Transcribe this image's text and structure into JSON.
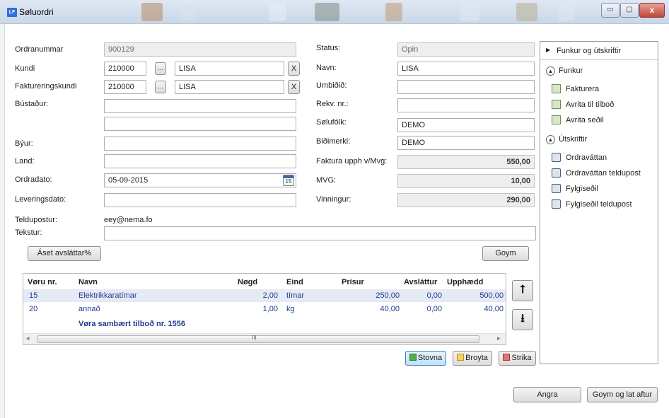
{
  "window": {
    "title": "Søluordri",
    "app_badge": "LF",
    "min": "▭",
    "max": "▢",
    "close": "x"
  },
  "form": {
    "labels": {
      "ordranummar": "Ordranummar",
      "kundi": "Kundi",
      "fakt_kundi": "Faktureringskundi",
      "bustadur": "Bústaður:",
      "byur": "Býur:",
      "land": "Land:",
      "ordradato": "Ordradato:",
      "leveringsdato": "Leveringsdato:",
      "teldupostur": "Teldupostur:",
      "tekstur": "Tekstur:",
      "status": "Status:",
      "navn": "Navn:",
      "umbidid": "Umbiðið:",
      "rekv": "Rekv. nr.:",
      "solufolk": "Sølufólk:",
      "bidimerki": "Biðimerki:",
      "faktura_upph": "Faktura upph v/Mvg:",
      "mvg": "MVG:",
      "vinningur": "Vinningur:"
    },
    "values": {
      "ordranummar": "900129",
      "kundi_nr": "210000",
      "kundi_navn": "LISA",
      "fakt_nr": "210000",
      "fakt_navn": "LISA",
      "bustadur1": "",
      "bustadur2": "",
      "byur": "",
      "land": "",
      "ordradato": "05-09-2015",
      "leveringsdato": "",
      "teldupostur": "eey@nema.fo",
      "tekstur": "",
      "status": "Opin",
      "navn": "LISA",
      "umbidid": "",
      "rekv": "",
      "solufolk": "DEMO",
      "bidimerki": "DEMO",
      "faktura_upph": "550,00",
      "mvg": "10,00",
      "vinningur": "290,00"
    },
    "browse_label": "...",
    "clear_label": "X",
    "calendar_day": "15",
    "aset_button": "Áset avsláttar%",
    "goym_button": "Goym"
  },
  "grid": {
    "headers": [
      "Vøru nr.",
      "Navn",
      "Nøgd",
      "Eind",
      "Prísur",
      "Avsláttur",
      "Upphædd"
    ],
    "rows": [
      {
        "nr": "15",
        "navn": "Elektrikkaratímar",
        "nogd": "2,00",
        "eind": "tímar",
        "prisur": "250,00",
        "avslattur": "0,00",
        "upphaedd": "500,00"
      },
      {
        "nr": "20",
        "navn": "annað",
        "nogd": "1,00",
        "eind": "kg",
        "prisur": "40,00",
        "avslattur": "0,00",
        "upphaedd": "40,00"
      }
    ],
    "footer_note": "Vøra sambært tilboð nr. 1556",
    "scroll_mark": "III",
    "up_arrow": "⭡",
    "down_arrow": "⭳"
  },
  "row_buttons": {
    "stovna": "Stovna",
    "broyta": "Broyta",
    "strika": "Strika"
  },
  "side_panel": {
    "header": "Funkur og útskriftir",
    "funkur_title": "Funkur",
    "funkur_items": [
      "Fakturera",
      "Avrita til tilboð",
      "Avrita seðil"
    ],
    "utskriftir_title": "Útskriftir",
    "utskriftir_items": [
      "Ordraváttan",
      "Ordraváttan teldupost",
      "Fylgiseðil",
      "Fylgiseðil teldupost"
    ]
  },
  "footer": {
    "angra": "Angra",
    "goym_lat": "Goym og lat aftur"
  },
  "colors": {
    "link_blue": "#1e3c8c",
    "titlebar": "#cfdcec"
  }
}
